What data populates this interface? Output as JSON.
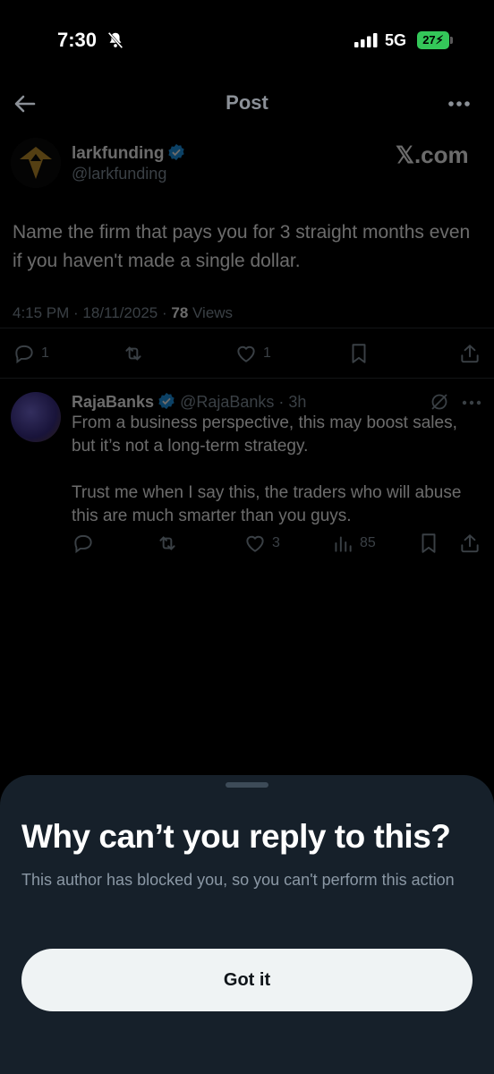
{
  "status_bar": {
    "time": "7:30",
    "network": "5G",
    "battery": "27"
  },
  "header": {
    "title": "Post"
  },
  "post": {
    "author_name": "larkfunding",
    "author_handle": "@larkfunding",
    "brand": "𝕏.com",
    "text": "Name the firm that pays you for 3 straight months even if you haven't made a single dollar.",
    "meta_time": "4:15 PM · 18/11/2025 · ",
    "views_count": "78",
    "views_label": " Views",
    "reply_count": "1",
    "like_count": "1"
  },
  "reply": {
    "name": "RajaBanks",
    "handle": "@RajaBanks · 3h",
    "text_p1": "From a business perspective, this may boost sales, but it’s not a long-term strategy.",
    "text_p2": "Trust me when I say this, the traders who will abuse this are much smarter than you guys.",
    "like_count": "3",
    "views_count": "85"
  },
  "sheet": {
    "title": "Why can’t you reply to this?",
    "body": "This author has blocked you, so you can't perform this action",
    "button_label": "Got it"
  },
  "colors": {
    "verified": "#1d9bf0",
    "sheet_bg": "#16202a",
    "battery": "#34c759"
  }
}
